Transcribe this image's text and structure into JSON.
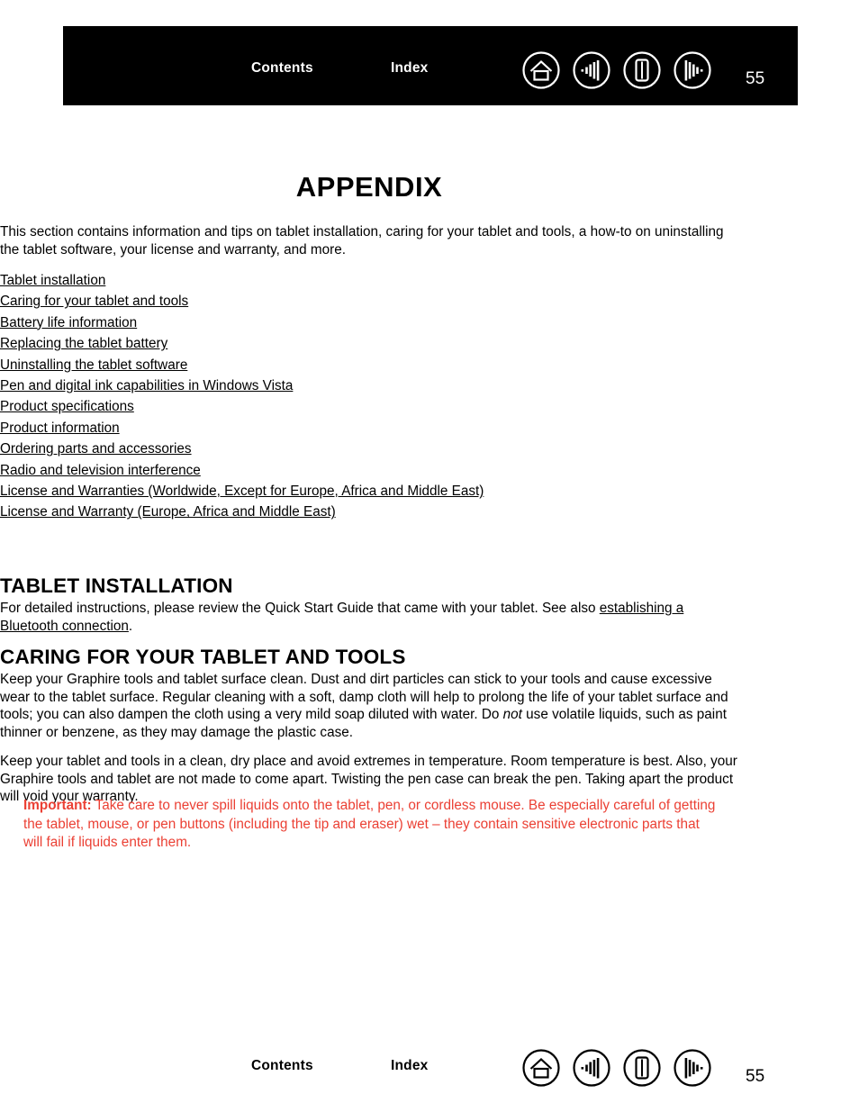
{
  "header": {
    "contents_label": "Contents",
    "index_label": "Index",
    "page_number": "55",
    "icons": [
      {
        "name": "home-icon",
        "label": "Home"
      },
      {
        "name": "go-back-icon",
        "label": "Go back"
      },
      {
        "name": "page-view-icon",
        "label": "Page view"
      },
      {
        "name": "go-forward-icon",
        "label": "Go forward"
      }
    ],
    "background_color": "#000000",
    "text_color": "#ffffff"
  },
  "footer": {
    "contents_label": "Contents",
    "index_label": "Index",
    "page_number": "55",
    "text_color": "#000000"
  },
  "main": {
    "title": "APPENDIX",
    "intro": "This section contains information and tips on tablet installation, caring for your tablet and tools, a how-to on uninstalling the tablet software, your license and warranty, and more.",
    "toc": [
      "Tablet installation",
      "Caring for your tablet and tools",
      "Battery life information",
      "Replacing the tablet battery",
      "Uninstalling the tablet software",
      "Pen and digital ink capabilities in Windows Vista",
      "Product specifications",
      "Product information",
      "Ordering parts and accessories",
      "Radio and television interference",
      "License and Warranties (Worldwide, Except for Europe, Africa and Middle East)",
      "License and Warranty (Europe, Africa and Middle East)"
    ],
    "sections": [
      {
        "heading": "TABLET INSTALLATION",
        "para_before_link": "For detailed instructions, please review the Quick Start Guide that came with your tablet.  See also ",
        "link_text": "establishing a Bluetooth connection",
        "para_after_link": "."
      },
      {
        "heading": "CARING FOR YOUR TABLET AND TOOLS",
        "para1_part1": "Keep your Graphire tools and tablet surface clean.  Dust and dirt particles can stick to your tools and cause excessive wear to the tablet surface.  Regular cleaning with a soft, damp cloth will help to prolong the life of your tablet surface and tools; you can also dampen the cloth using a very mild soap diluted with water. Do ",
        "para1_italic": "not",
        "para1_part2": " use volatile liquids, such as paint thinner or benzene, as they may damage the plastic case.",
        "para2": "Keep your tablet and tools in a clean, dry place and avoid extremes in temperature.  Room temperature is best.  Also, your Graphire tools and tablet are not made to come apart.  Twisting the pen case can break the pen.  Taking apart the product will void your warranty."
      }
    ],
    "important": {
      "label": "Important:",
      "text": " Take care to never spill liquids onto the tablet, pen, or cordless mouse.  Be especially careful of getting the tablet, mouse, or pen buttons (including the tip and eraser) wet – they contain sensitive electronic parts that will fail if liquids enter them.",
      "color": "#eb4034"
    }
  }
}
